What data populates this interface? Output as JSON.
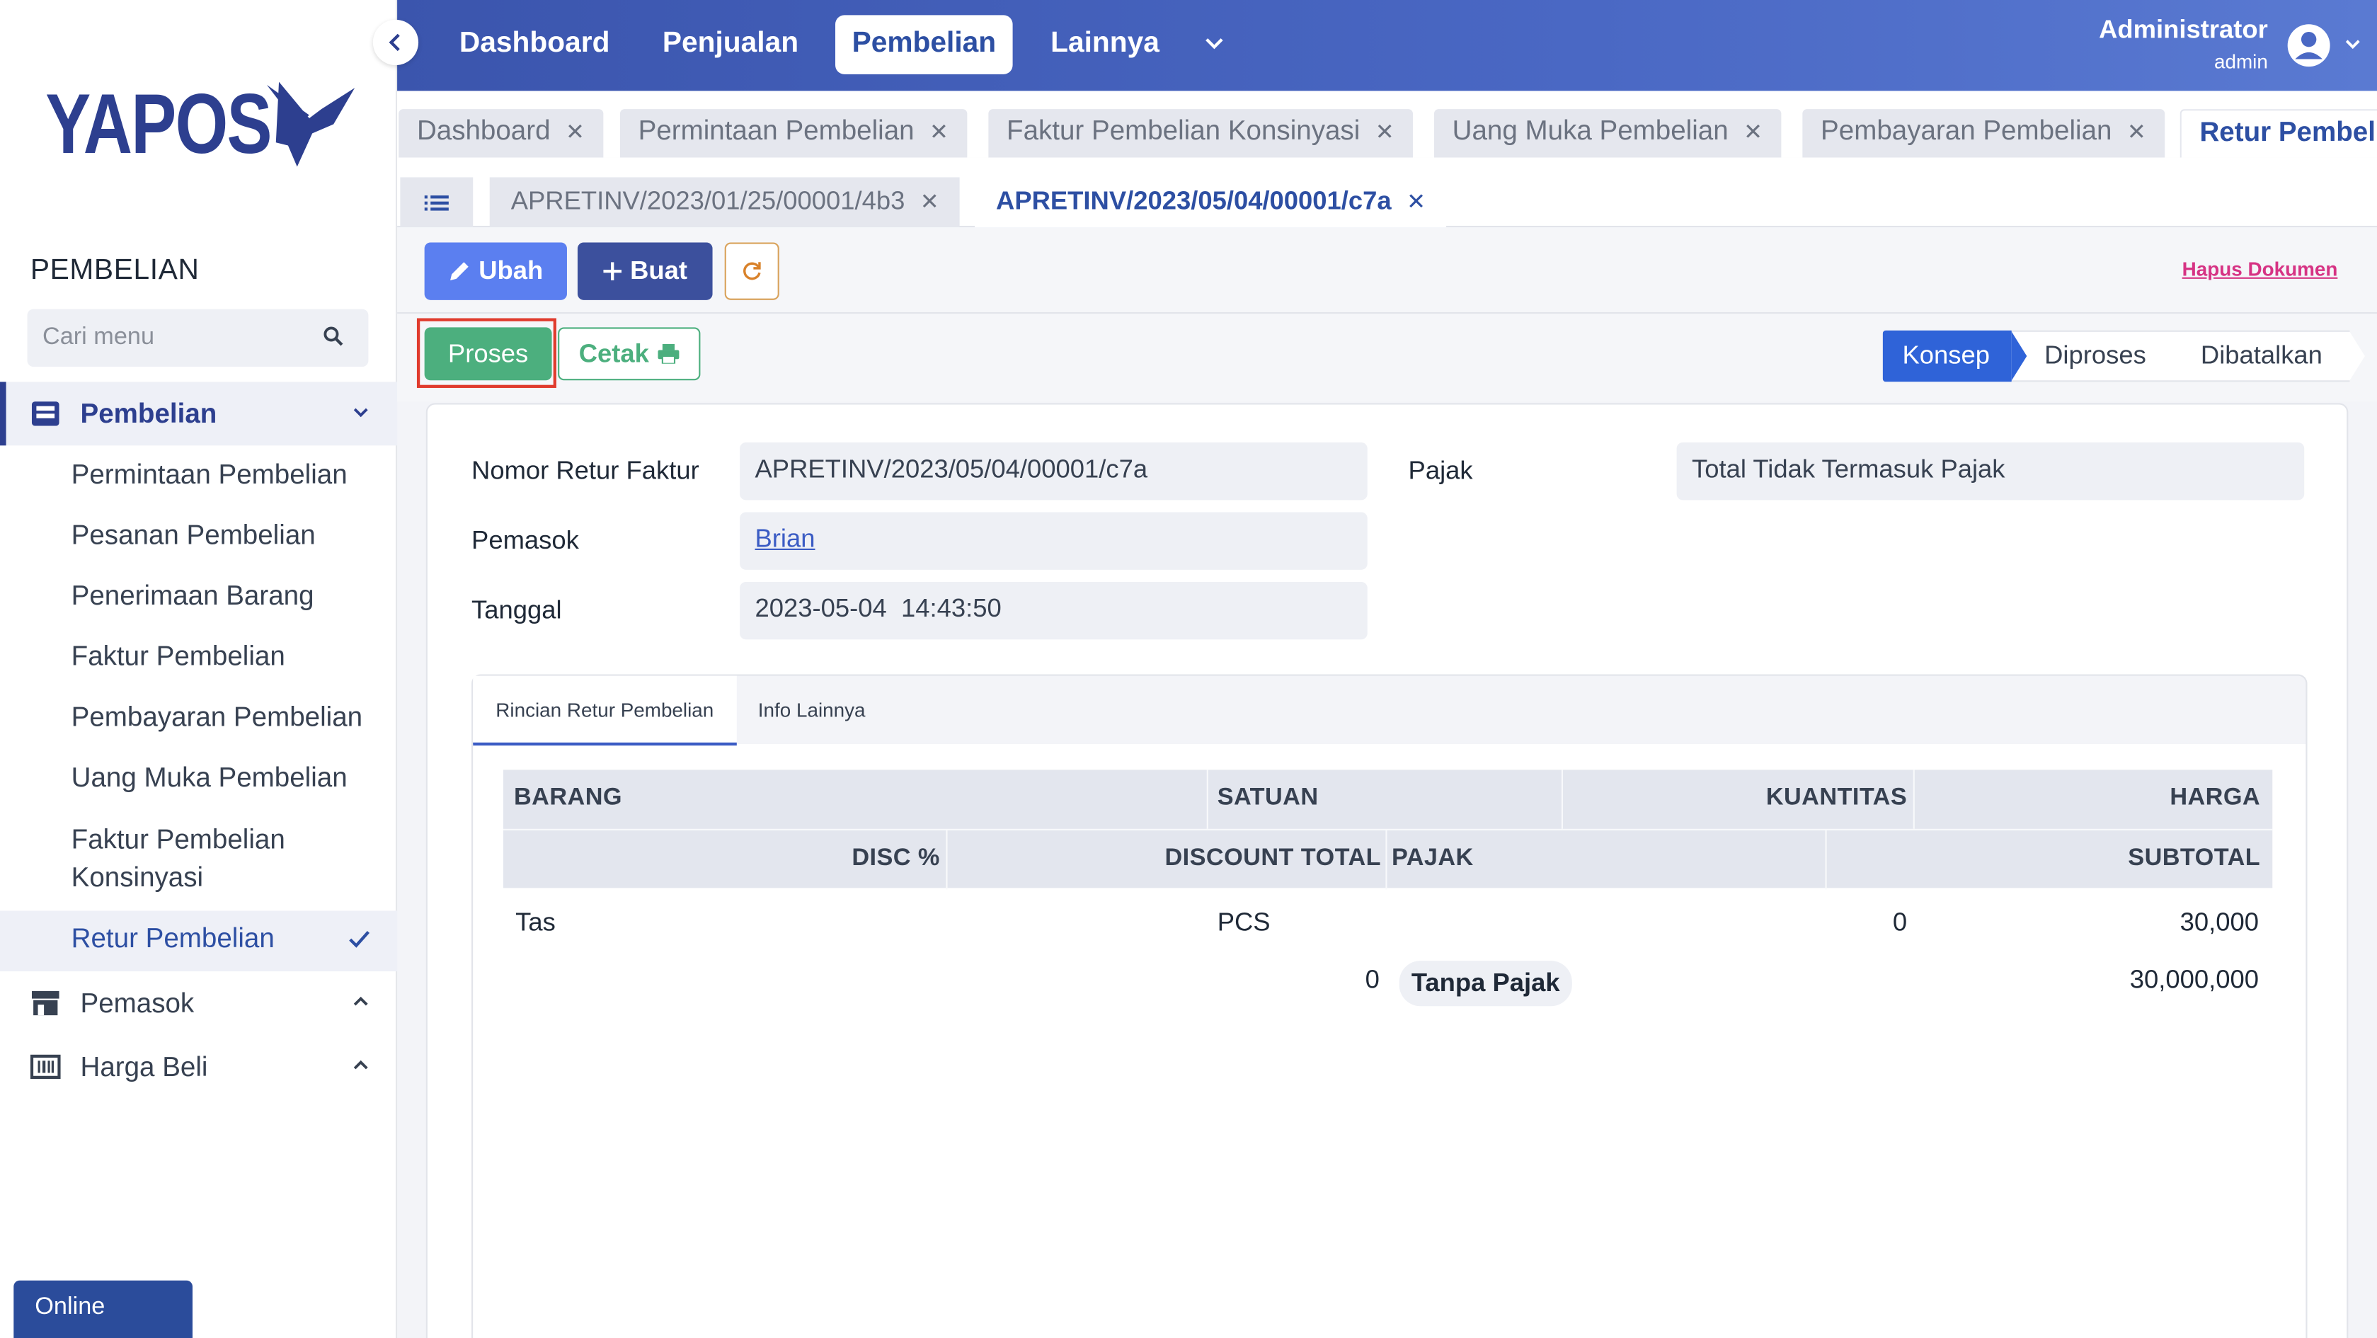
{
  "brand": {
    "name": "YAPOS"
  },
  "sidebar": {
    "section_title": "PEMBELIAN",
    "search_placeholder": "Cari menu",
    "groups": [
      {
        "label": "Pembelian",
        "icon": "inbox-icon",
        "expanded": true
      },
      {
        "label": "Pemasok",
        "icon": "store-icon",
        "expanded": false
      },
      {
        "label": "Harga Beli",
        "icon": "barcode-icon",
        "expanded": false
      }
    ],
    "items": [
      "Permintaan Pembelian",
      "Pesanan Pembelian",
      "Penerimaan Barang",
      "Faktur Pembelian",
      "Pembayaran Pembelian",
      "Uang Muka Pembelian",
      "Faktur Pembelian Konsinyasi",
      "Retur Pembelian"
    ],
    "status": "Online"
  },
  "topnav": {
    "items": [
      "Dashboard",
      "Penjualan",
      "Pembelian",
      "Lainnya"
    ],
    "active": "Pembelian",
    "user_name": "Administrator",
    "user_role": "admin"
  },
  "tabs": [
    {
      "label": "Dashboard"
    },
    {
      "label": "Permintaan Pembelian"
    },
    {
      "label": "Faktur Pembelian Konsinyasi"
    },
    {
      "label": "Uang Muka Pembelian"
    },
    {
      "label": "Pembayaran Pembelian"
    },
    {
      "label": "Retur Pembelian"
    }
  ],
  "doc_tabs": [
    {
      "label": "APRETINV/2023/01/25/00001/4b3"
    },
    {
      "label": "APRETINV/2023/05/04/00001/c7a"
    }
  ],
  "toolbar": {
    "edit_label": "Ubah",
    "create_label": "Buat",
    "delete_label": "Hapus Dokumen",
    "process_label": "Proses",
    "print_label": "Cetak"
  },
  "status_stages": [
    "Konsep",
    "Diproses",
    "Dibatalkan"
  ],
  "form": {
    "nomor_label": "Nomor Retur Faktur",
    "nomor_value": "APRETINV/2023/05/04/00001/c7a",
    "pemasok_label": "Pemasok",
    "pemasok_value": "Brian",
    "tanggal_label": "Tanggal",
    "tanggal_value": "2023-05-04  14:43:50",
    "pajak_label": "Pajak",
    "pajak_value": "Total Tidak Termasuk Pajak"
  },
  "inner_tabs": [
    "Rincian Retur Pembelian",
    "Info Lainnya"
  ],
  "table": {
    "headers_row1": [
      "BARANG",
      "SATUAN",
      "KUANTITAS",
      "HARGA"
    ],
    "headers_row2": [
      "DISC %",
      "DISCOUNT TOTAL",
      "PAJAK",
      "SUBTOTAL"
    ],
    "rows": [
      {
        "barang": "Tas",
        "satuan": "PCS",
        "kuantitas": "0",
        "harga": "30,000",
        "discount_total": "0",
        "pajak": "Tanpa Pajak",
        "subtotal": "30,000,000"
      }
    ]
  },
  "colors": {
    "topbar": "#3b55ad",
    "primary": "#2d3f8f",
    "process": "#4caf7e",
    "highlight": "#e03b2d"
  }
}
